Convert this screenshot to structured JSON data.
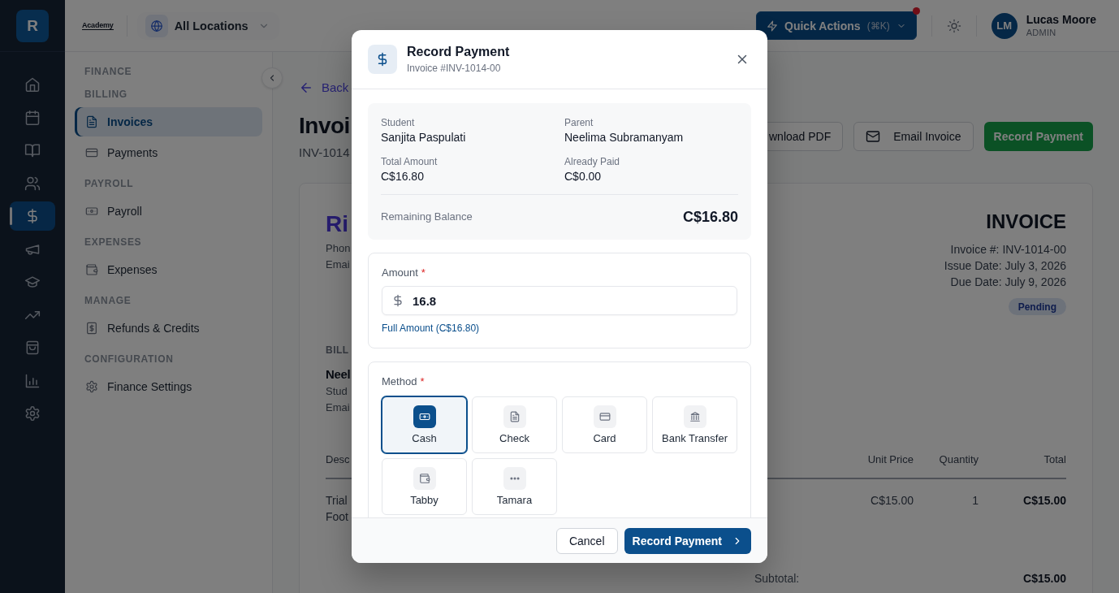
{
  "rail": {
    "logo": "R",
    "items": [
      {
        "selected": false
      },
      {
        "selected": false
      },
      {
        "selected": false
      },
      {
        "selected": false
      },
      {
        "selected": true
      },
      {
        "selected": false
      },
      {
        "selected": false
      },
      {
        "selected": false
      },
      {
        "selected": false
      },
      {
        "selected": false
      },
      {
        "selected": false
      }
    ]
  },
  "header": {
    "brand": "Academy",
    "location": "All Locations",
    "quick_actions": {
      "label": "Quick Actions",
      "shortcut": "(⌘K)",
      "notification": true
    },
    "user": {
      "initials": "LM",
      "name": "Lucas Moore",
      "role": "ADMIN"
    }
  },
  "sidebar": {
    "title": "FINANCE",
    "groups": [
      {
        "heading": "BILLING",
        "items": [
          {
            "label": "Invoices",
            "selected": true
          },
          {
            "label": "Payments",
            "selected": false
          }
        ]
      },
      {
        "heading": "PAYROLL",
        "items": [
          {
            "label": "Payroll",
            "selected": false
          }
        ]
      },
      {
        "heading": "EXPENSES",
        "items": [
          {
            "label": "Expenses",
            "selected": false
          }
        ]
      },
      {
        "heading": "MANAGE",
        "items": [
          {
            "label": "Refunds & Credits",
            "selected": false
          }
        ]
      },
      {
        "heading": "CONFIGURATION",
        "items": [
          {
            "label": "Finance Settings",
            "selected": false
          }
        ]
      }
    ]
  },
  "page": {
    "back": "Back",
    "title": "Invoi",
    "number": "INV-1014",
    "actions": [
      {
        "label": "wnload PDF",
        "kind": "secondary"
      },
      {
        "label": "Email Invoice",
        "kind": "secondary"
      },
      {
        "label": "Record Payment",
        "kind": "primary"
      }
    ]
  },
  "invoice": {
    "school": "Ri",
    "school_lines": [
      "Phon",
      "Emai"
    ],
    "heading": "INVOICE",
    "meta": [
      "Invoice #: INV-1014-00",
      "Issue Date: July 3, 2026",
      "Due Date: July 9, 2026"
    ],
    "status": "Pending",
    "bill_to": {
      "heading": "BILL",
      "name": "Neel",
      "lines": [
        "Stud",
        "Emai"
      ]
    },
    "table": {
      "columns": [
        "Desc",
        "Unit Price",
        "Quantity",
        "Total"
      ],
      "rows": [
        {
          "description": [
            "Trial",
            "Foot"
          ],
          "unit_price": "C$15.00",
          "quantity": "1",
          "total": "C$15.00"
        }
      ]
    },
    "subtotal": {
      "label": "Subtotal:",
      "value": "C$15.00"
    }
  },
  "dialog": {
    "title": "Record Payment",
    "subtitle": "Invoice #INV-1014-00",
    "summary": {
      "fields": [
        {
          "label": "Student",
          "value": "Sanjita Paspulati"
        },
        {
          "label": "Parent",
          "value": "Neelima Subramanyam"
        },
        {
          "label": "Total Amount",
          "value": "C$16.80"
        },
        {
          "label": "Already Paid",
          "value": "C$0.00"
        }
      ],
      "balance_label": "Remaining Balance",
      "balance": "C$16.80"
    },
    "amount": {
      "label": "Amount",
      "required_mark": "*",
      "value": "16.8",
      "full_amount_link": "Full Amount (C$16.80)"
    },
    "method": {
      "label": "Method",
      "required_mark": "*",
      "options": [
        {
          "label": "Cash",
          "selected": true
        },
        {
          "label": "Check",
          "selected": false
        },
        {
          "label": "Card",
          "selected": false
        },
        {
          "label": "Bank Transfer",
          "selected": false
        },
        {
          "label": "Tabby",
          "selected": false
        },
        {
          "label": "Tamara",
          "selected": false
        }
      ]
    },
    "buttons": [
      {
        "label": "Cancel",
        "kind": "secondary"
      },
      {
        "label": "Record Payment",
        "kind": "primary"
      }
    ]
  }
}
